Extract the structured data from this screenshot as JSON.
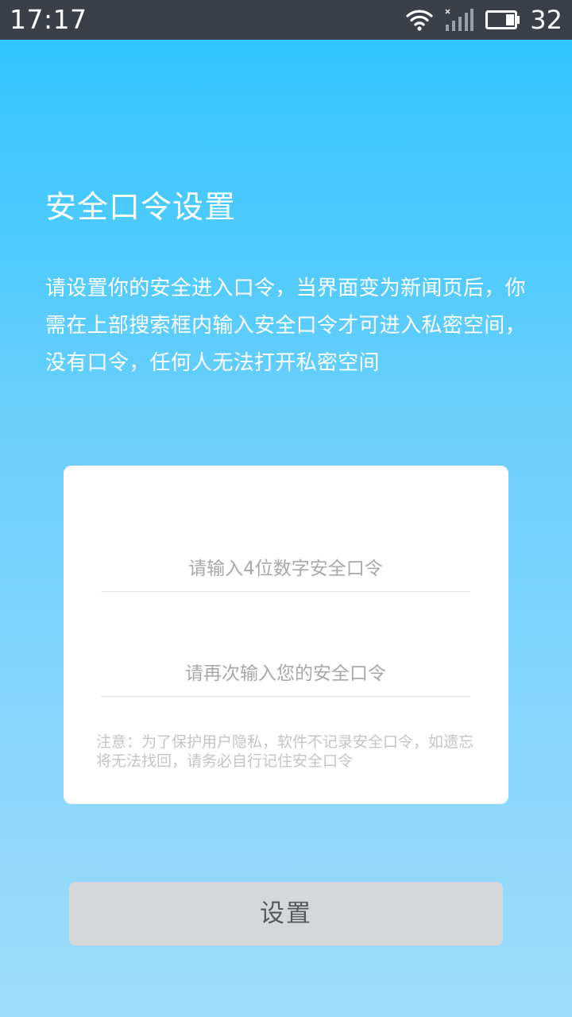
{
  "status_bar": {
    "time": "17:17",
    "battery_level": "32",
    "icons": [
      "wifi-icon",
      "signal-icon",
      "battery-icon"
    ]
  },
  "header": {
    "title": "安全口令设置",
    "description": "请设置你的安全进入口令，当界面变为新闻页后，你需在上部搜索框内输入安全口令才可进入私密空间，没有口令，任何人无法打开私密空间"
  },
  "form": {
    "password_placeholder": "请输入4位数字安全口令",
    "password_value": "",
    "confirm_placeholder": "请再次输入您的安全口令",
    "confirm_value": "",
    "notice": "注意：为了保护用户隐私，软件不记录安全口令，如遗忘将无法找回，请务必自行记住安全口令"
  },
  "actions": {
    "submit_label": "设置"
  },
  "colors": {
    "status_bar_bg": "#3b3f48",
    "background_top": "#2ac4fd",
    "background_bottom": "#9fdcfb",
    "card_bg": "#ffffff",
    "button_bg": "#d6d7d9",
    "button_text": "#555a60"
  }
}
